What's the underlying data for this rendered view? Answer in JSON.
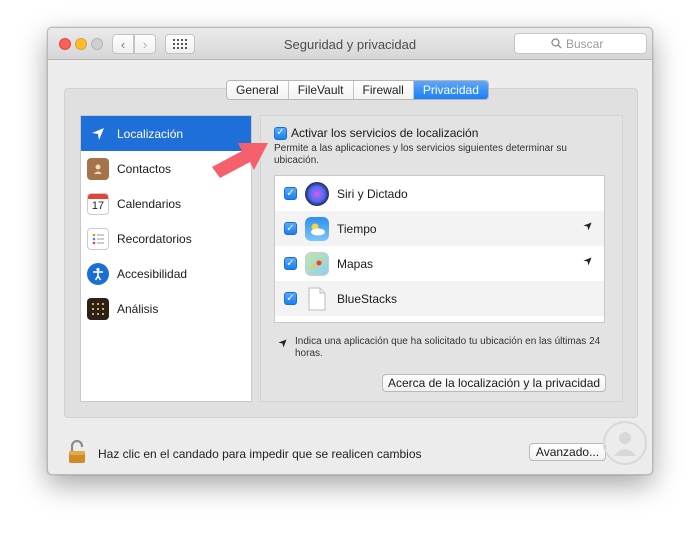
{
  "window": {
    "title": "Seguridad y privacidad"
  },
  "search": {
    "placeholder": "Buscar"
  },
  "tabs": [
    {
      "label": "General"
    },
    {
      "label": "FileVault"
    },
    {
      "label": "Firewall"
    },
    {
      "label": "Privacidad",
      "active": true
    }
  ],
  "sidebar": {
    "items": [
      {
        "label": "Localización",
        "icon": "location-arrow-icon",
        "selected": true
      },
      {
        "label": "Contactos",
        "icon": "contacts-book-icon"
      },
      {
        "label": "Calendarios",
        "icon": "calendar-icon",
        "icon_text": "17"
      },
      {
        "label": "Recordatorios",
        "icon": "reminders-list-icon"
      },
      {
        "label": "Accesibilidad",
        "icon": "accessibility-icon"
      },
      {
        "label": "Análisis",
        "icon": "analytics-grid-icon"
      }
    ]
  },
  "location": {
    "enable_label": "Activar los servicios de localización",
    "enable_checked": true,
    "description": "Permite a las aplicaciones y los servicios siguientes determinar su ubicación."
  },
  "apps": [
    {
      "name": "Siri y Dictado",
      "checked": true,
      "icon": "siri-icon",
      "recent": false
    },
    {
      "name": "Tiempo",
      "checked": true,
      "icon": "weather-icon",
      "recent": true
    },
    {
      "name": "Mapas",
      "checked": true,
      "icon": "maps-icon",
      "recent": true
    },
    {
      "name": "BlueStacks",
      "checked": true,
      "icon": "document-icon",
      "recent": false
    }
  ],
  "note": "Indica una aplicación que ha solicitado tu ubicación en las últimas 24 horas.",
  "buttons": {
    "about": "Acerca de la localización y la privacidad",
    "advanced": "Avanzado..."
  },
  "footer": {
    "lock_text": "Haz clic en el candado para impedir que se realicen cambios"
  },
  "colors": {
    "accent": "#1f6fd8",
    "annotation_arrow": "#f4606c"
  }
}
